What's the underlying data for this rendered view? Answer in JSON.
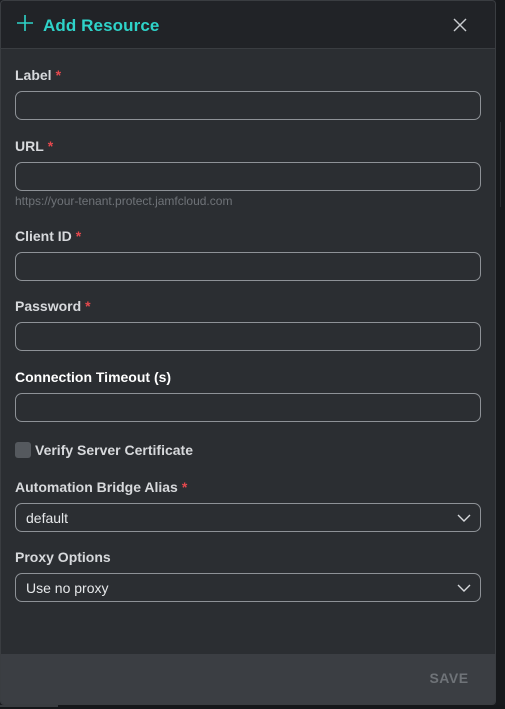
{
  "modal": {
    "title": "Add Resource"
  },
  "form": {
    "required_marker": "*",
    "label_field": {
      "label": "Label",
      "value": ""
    },
    "url_field": {
      "label": "URL",
      "value": "",
      "hint": "https://your-tenant.protect.jamfcloud.com"
    },
    "client_id_field": {
      "label": "Client ID",
      "value": ""
    },
    "password_field": {
      "label": "Password",
      "value": ""
    },
    "timeout_field": {
      "label": "Connection Timeout (s)",
      "value": ""
    },
    "verify_cert": {
      "label": "Verify Server Certificate",
      "checked": false
    },
    "bridge_alias": {
      "label": "Automation Bridge Alias",
      "selected": "default"
    },
    "proxy_options": {
      "label": "Proxy Options",
      "selected": "Use no proxy"
    }
  },
  "footer": {
    "save_label": "SAVE"
  },
  "icons": {
    "add": "plus-icon",
    "close": "close-icon",
    "dropdown": "chevron-down-icon"
  },
  "colors": {
    "accent": "#2ed3c9",
    "required": "#e5484d",
    "modal_bg": "#2b2e32",
    "header_bg": "#212327",
    "footer_bg": "#3b3e43"
  }
}
